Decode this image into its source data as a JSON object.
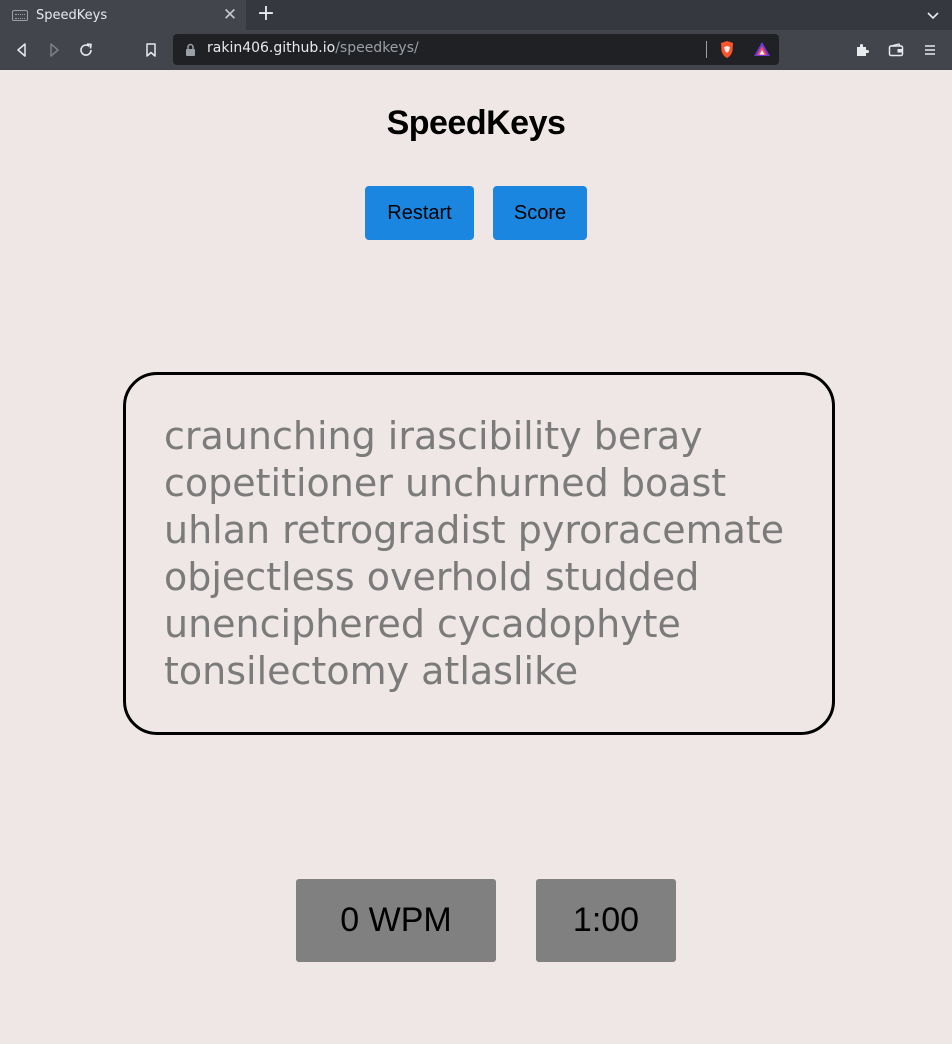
{
  "browser": {
    "tab_title": "SpeedKeys",
    "tab_close_glyph": "✕",
    "new_tab_glyph": "+",
    "url_host": "rakin406.github.io",
    "url_path": "/speedkeys/",
    "icons": [
      "back-icon",
      "forward-icon",
      "reload-icon",
      "bookmark-icon",
      "lock-icon",
      "brave-shield-icon",
      "brave-rewards-icon",
      "extensions-icon",
      "wallet-icon",
      "menu-icon",
      "tab-list-icon"
    ]
  },
  "page": {
    "title": "SpeedKeys",
    "restart_label": "Restart",
    "score_label": "Score",
    "words_lines": [
      "craunching irascibility beray",
      "copetitioner unchurned boast",
      "uhlan retrogradist pyroracemate",
      "objectless overhold studded",
      "unenciphered cycadophyte",
      "tonsilectomy atlaslike"
    ],
    "wpm_display": "0 WPM",
    "timer_display": "1:00"
  },
  "colors": {
    "page_background": "#efe7e5",
    "button_blue": "#1a86e0",
    "stat_gray": "#808080",
    "word_gray": "#7b7b7b"
  }
}
